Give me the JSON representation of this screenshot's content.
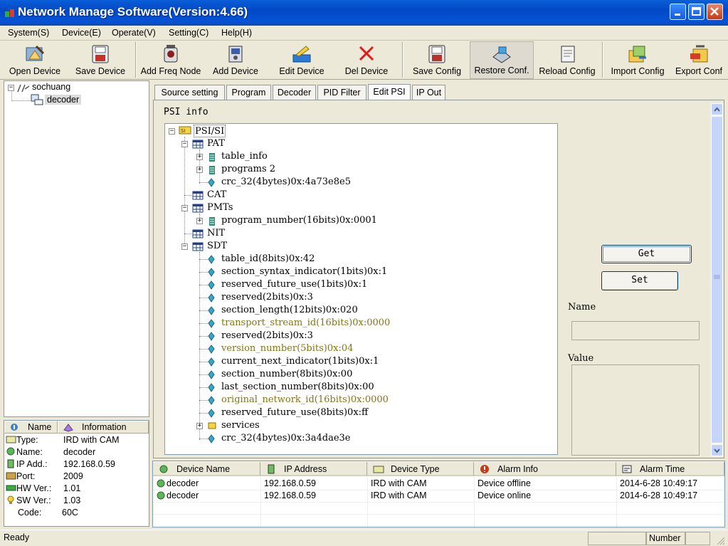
{
  "window": {
    "title": "Network Manage Software(Version:4.66)"
  },
  "menu": [
    "System(S)",
    "Device(E)",
    "Operate(V)",
    "Setting(C)",
    "Help(H)"
  ],
  "toolbar": [
    {
      "label": "Open Device",
      "icon": "open-device-icon"
    },
    {
      "label": "Save Device",
      "icon": "save-device-icon"
    },
    {
      "label": "Add Freq Node",
      "icon": "add-freq-node-icon"
    },
    {
      "label": "Add Device",
      "icon": "add-device-icon"
    },
    {
      "label": "Edit Device",
      "icon": "edit-device-icon"
    },
    {
      "label": "Del Device",
      "icon": "delete-device-icon"
    },
    {
      "label": "Save Config",
      "icon": "save-config-icon"
    },
    {
      "label": "Restore Conf.",
      "icon": "restore-config-icon"
    },
    {
      "label": "Reload Config",
      "icon": "reload-config-icon"
    },
    {
      "label": "Import Config",
      "icon": "import-config-icon"
    },
    {
      "label": "Export Conf",
      "icon": "export-config-icon"
    }
  ],
  "device_tree": {
    "root": "sochuang",
    "child": "decoder"
  },
  "info": {
    "headers": [
      "Name",
      "Information"
    ],
    "rows": [
      {
        "label": "Type:",
        "value": "IRD with CAM"
      },
      {
        "label": "Name:",
        "value": "decoder"
      },
      {
        "label": "IP Add.:",
        "value": "192.168.0.59"
      },
      {
        "label": "Port:",
        "value": "2009"
      },
      {
        "label": "HW Ver.:",
        "value": "1.01"
      },
      {
        "label": "SW Ver.:",
        "value": "1.03"
      },
      {
        "label": "Code:",
        "value": "60C"
      }
    ]
  },
  "tabs": [
    "Source setting",
    "Program",
    "Decoder",
    "PID Filter",
    "Edit PSI",
    "IP Out"
  ],
  "active_tab": "Edit PSI",
  "psi": {
    "label": "PSI info",
    "root": "PSI/SI",
    "nodes": [
      "PAT",
      "table_info",
      "programs 2",
      "crc_32(4bytes)0x:4a73e8e5",
      "CAT",
      "PMTs",
      "program_number(16bits)0x:0001",
      "NIT",
      "SDT",
      "table_id(8bits)0x:42",
      "section_syntax_indicator(1bits)0x:1",
      "reserved_future_use(1bits)0x:1",
      "reserved(2bits)0x:3",
      "section_length(12bits)0x:020",
      "transport_stream_id(16bits)0x:0000",
      "reserved(2bits)0x:3",
      "version_number(5bits)0x:04",
      "current_next_indicator(1bits)0x:1",
      "section_number(8bits)0x:00",
      "last_section_number(8bits)0x:00",
      "original_network_id(16bits)0x:0000",
      "reserved_future_use(8bits)0x:ff",
      "services",
      "crc_32(4bytes)0x:3a4dae3e"
    ]
  },
  "edit": {
    "get_label": "Get",
    "set_label": "Set",
    "name_label": "Name",
    "value_label": "Value"
  },
  "alarm": {
    "headers": [
      "Device Name",
      "IP Address",
      "Device Type",
      "Alarm Info",
      "Alarm Time"
    ],
    "rows": [
      [
        "decoder",
        "192.168.0.59",
        "IRD with CAM",
        "Device offline",
        "2014-6-28 10:49:17"
      ],
      [
        "decoder",
        "192.168.0.59",
        "IRD with CAM",
        "Device online",
        "2014-6-28 10:49:17"
      ]
    ]
  },
  "status": {
    "text": "Ready",
    "number_label": "Number"
  },
  "colors": {
    "titlebar": "#0348c6",
    "highlight_text": "#827519",
    "face": "#ece9d8"
  }
}
